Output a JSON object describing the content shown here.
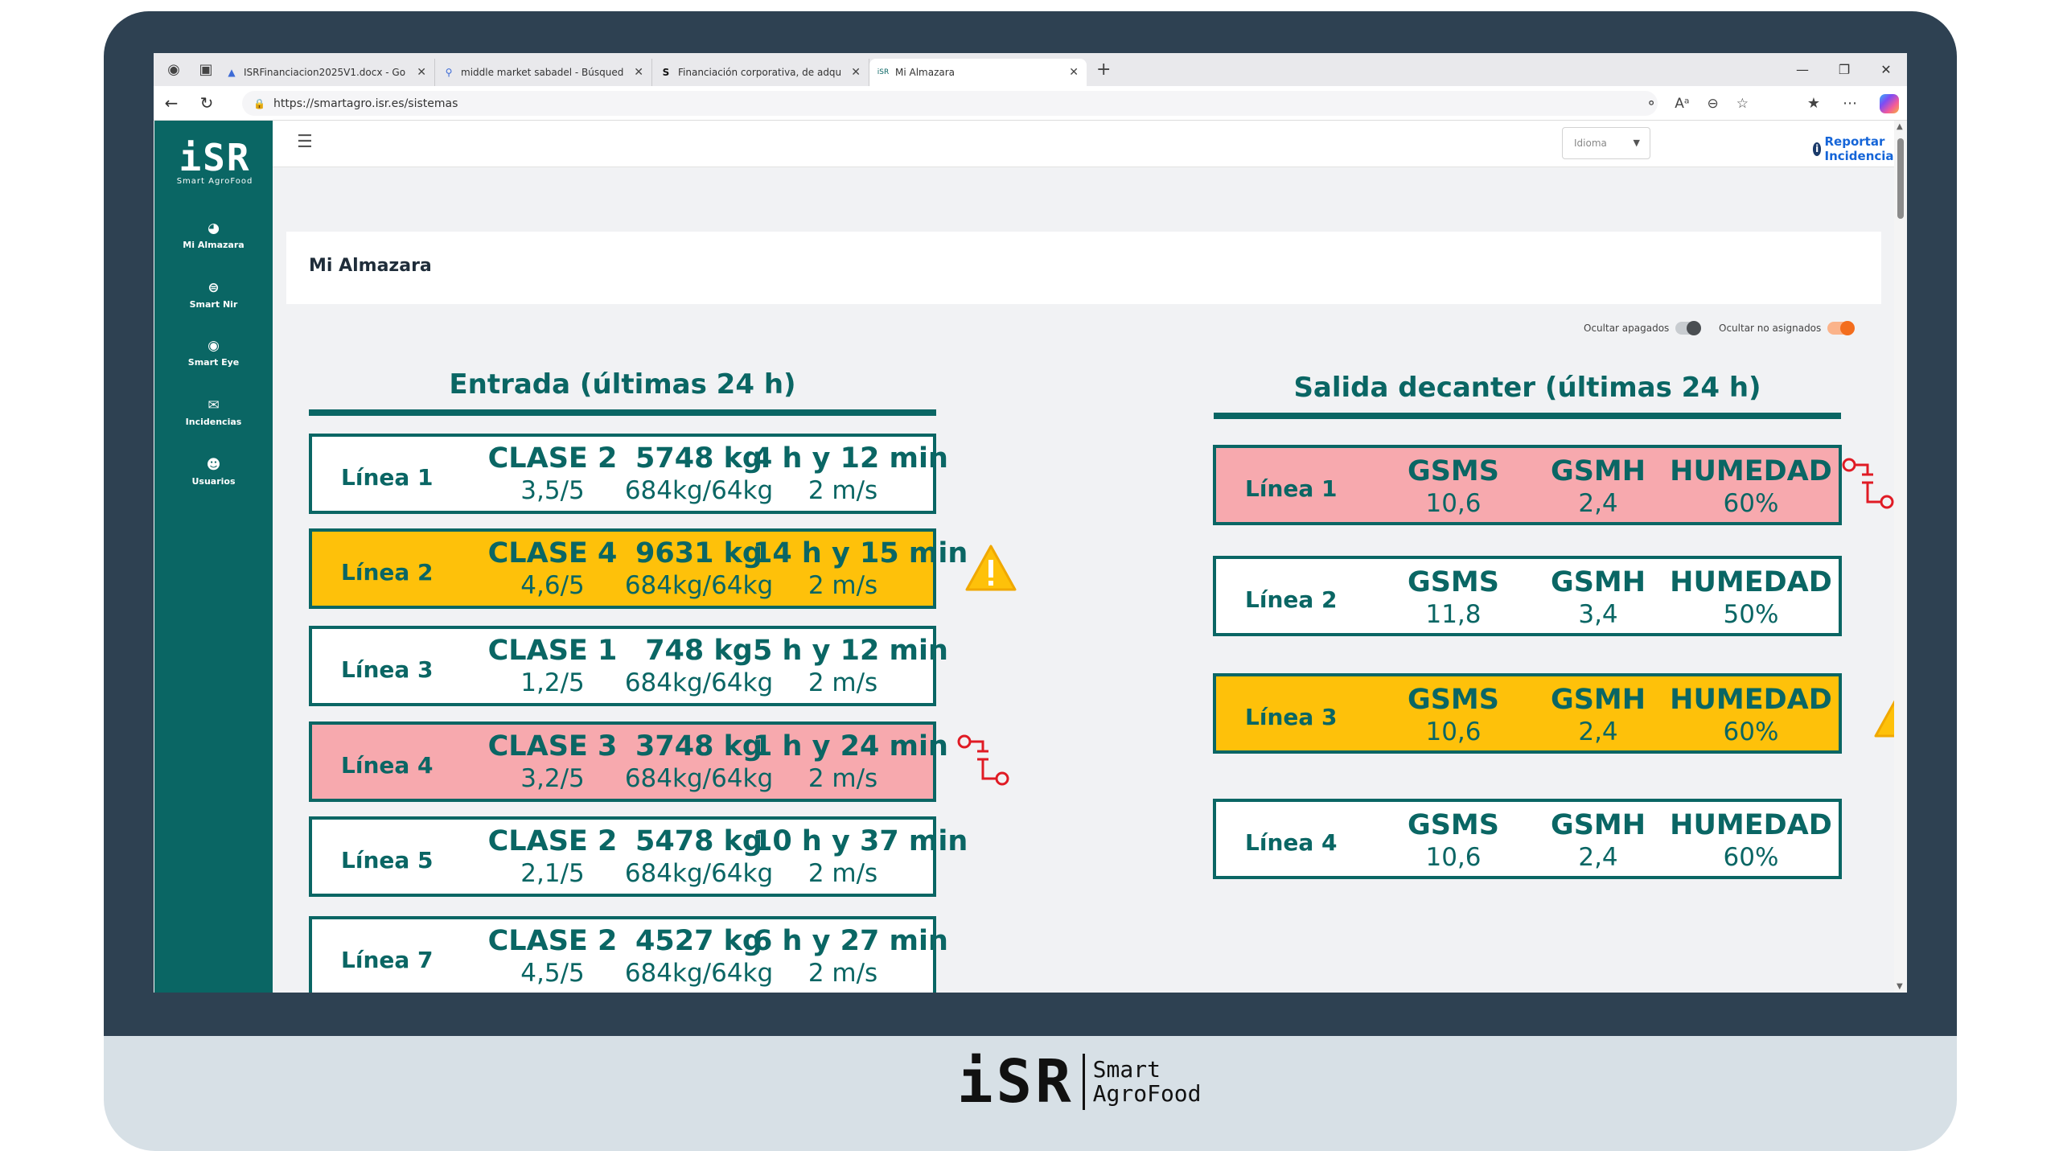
{
  "browser": {
    "tabs": [
      {
        "title": "ISRFinanciacion2025V1.docx - Go",
        "favicon": "drive-icon"
      },
      {
        "title": "middle market sabadel - Búsqued",
        "favicon": "search-icon"
      },
      {
        "title": "Financiación corporativa, de adqu",
        "favicon": "sabadell-icon"
      },
      {
        "title": "Mi Almazara",
        "favicon": "isr-icon"
      }
    ],
    "url": "https://smartagro.isr.es/sistemas"
  },
  "sidebar": {
    "brand": "iSR",
    "brand_sub": "Smart AgroFood",
    "items": [
      {
        "label": "Mi Almazara",
        "icon": "olive-icon"
      },
      {
        "label": "Smart Nir",
        "icon": "sensor-icon"
      },
      {
        "label": "Smart Eye",
        "icon": "eye-sensor-icon"
      },
      {
        "label": "Incidencias",
        "icon": "mail-icon"
      },
      {
        "label": "Usuarios",
        "icon": "users-icon"
      }
    ]
  },
  "topbar": {
    "language_placeholder": "Idioma",
    "report_label": "Reportar Incidencia"
  },
  "page": {
    "title": "Mi Almazara",
    "toggle_off_label": "Ocultar apagados",
    "toggle_on_label": "Ocultar no asignados"
  },
  "entrada": {
    "title": "Entrada (últimas 24 h)",
    "rows": [
      {
        "name": "Línea 1",
        "clase": "CLASE 2",
        "score": "3,5/5",
        "kg": "5748 kg",
        "ratio": "684kg/64kg",
        "time": "4 h y 12 min",
        "speed": "2 m/s",
        "status": "normal"
      },
      {
        "name": "Línea 2",
        "clase": "CLASE 4",
        "score": "4,6/5",
        "kg": "9631 kg",
        "ratio": "684kg/64kg",
        "time": "14 h y 15 min",
        "speed": "2 m/s",
        "status": "warning"
      },
      {
        "name": "Línea 3",
        "clase": "CLASE 1",
        "score": "1,2/5",
        "kg": "748 kg",
        "ratio": "684kg/64kg",
        "time": "5 h y 12 min",
        "speed": "2 m/s",
        "status": "normal"
      },
      {
        "name": "Línea 4",
        "clase": "CLASE 3",
        "score": "3,2/5",
        "kg": "3748 kg",
        "ratio": "684kg/64kg",
        "time": "1 h y 24 min",
        "speed": "2 m/s",
        "status": "alarm"
      },
      {
        "name": "Línea 5",
        "clase": "CLASE 2",
        "score": "2,1/5",
        "kg": "5478 kg",
        "ratio": "684kg/64kg",
        "time": "10 h y 37 min",
        "speed": "2 m/s",
        "status": "normal"
      },
      {
        "name": "Línea 7",
        "clase": "CLASE 2",
        "score": "4,5/5",
        "kg": "4527 kg",
        "ratio": "684kg/64kg",
        "time": "6 h y 27 min",
        "speed": "2 m/s",
        "status": "normal"
      }
    ]
  },
  "salida": {
    "title": "Salida decanter (últimas 24 h)",
    "rows": [
      {
        "name": "Línea 1",
        "gsms": "10,6",
        "gsmh": "2,4",
        "humedad": "60%",
        "status": "alarm"
      },
      {
        "name": "Línea 2",
        "gsms": "11,8",
        "gsmh": "3,4",
        "humedad": "50%",
        "status": "normal"
      },
      {
        "name": "Línea 3",
        "gsms": "10,6",
        "gsmh": "2,4",
        "humedad": "60%",
        "status": "warning"
      },
      {
        "name": "Línea 4",
        "gsms": "10,6",
        "gsmh": "2,4",
        "humedad": "60%",
        "status": "normal"
      }
    ],
    "labels": {
      "gsms": "GSMS",
      "gsmh": "GSMH",
      "humedad": "HUMEDAD"
    }
  },
  "footer": {
    "logo": "iSR",
    "line1": "Smart",
    "line2": "AgroFood"
  },
  "colors": {
    "primary": "#0a6664",
    "warning": "#fec10a",
    "alarm": "#f7a9ae",
    "frame": "#2e4152"
  }
}
